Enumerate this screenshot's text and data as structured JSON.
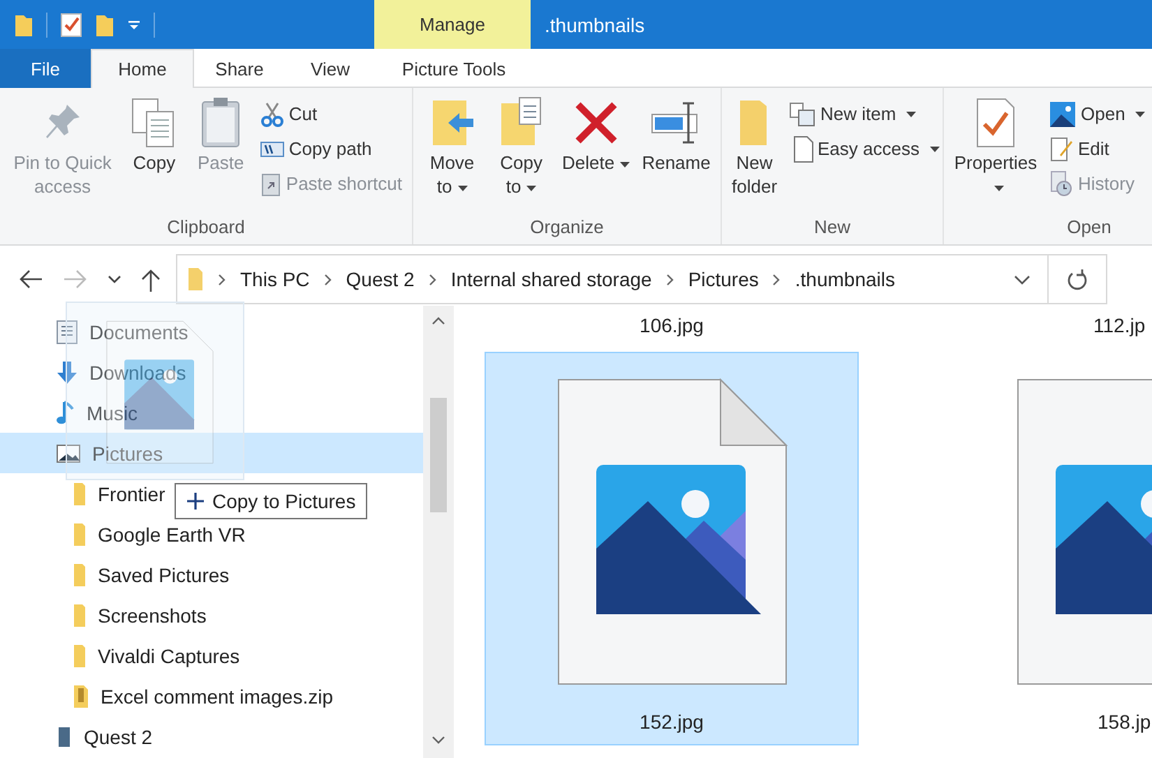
{
  "window": {
    "title": ".thumbnails"
  },
  "contextual_tab": {
    "label": "Manage"
  },
  "ribbon_tabs": [
    {
      "label": "File",
      "kind": "file",
      "selected": false
    },
    {
      "label": "Home",
      "kind": "tab",
      "selected": true
    },
    {
      "label": "Share",
      "kind": "tab",
      "selected": false
    },
    {
      "label": "View",
      "kind": "tab",
      "selected": false
    },
    {
      "label": "Picture Tools",
      "kind": "tab",
      "selected": false
    }
  ],
  "ribbon_groups": [
    {
      "label": "Clipboard",
      "commands": [
        {
          "label": "Pin to Quick access",
          "kind": "large",
          "disabled": true,
          "dropdown": false
        },
        {
          "label": "Copy",
          "kind": "large",
          "disabled": false,
          "dropdown": false
        },
        {
          "label": "Paste",
          "kind": "large",
          "disabled": true,
          "dropdown": false
        },
        {
          "label": "Cut",
          "kind": "small",
          "disabled": false,
          "dropdown": false
        },
        {
          "label": "Copy path",
          "kind": "small",
          "disabled": false,
          "dropdown": false
        },
        {
          "label": "Paste shortcut",
          "kind": "small",
          "disabled": true,
          "dropdown": false
        }
      ]
    },
    {
      "label": "Organize",
      "commands": [
        {
          "label": "Move to",
          "kind": "large",
          "disabled": false,
          "dropdown": true
        },
        {
          "label": "Copy to",
          "kind": "large",
          "disabled": false,
          "dropdown": true
        },
        {
          "label": "Delete",
          "kind": "large",
          "disabled": false,
          "dropdown": true
        },
        {
          "label": "Rename",
          "kind": "large",
          "disabled": false,
          "dropdown": false
        }
      ]
    },
    {
      "label": "New",
      "commands": [
        {
          "label": "New folder",
          "kind": "large",
          "disabled": false,
          "dropdown": false
        },
        {
          "label": "New item",
          "kind": "small",
          "disabled": false,
          "dropdown": true
        },
        {
          "label": "Easy access",
          "kind": "small",
          "disabled": false,
          "dropdown": true
        }
      ]
    },
    {
      "label": "Open",
      "commands": [
        {
          "label": "Properties",
          "kind": "large",
          "disabled": false,
          "dropdown": true
        },
        {
          "label": "Open",
          "kind": "small",
          "disabled": false,
          "dropdown": true
        },
        {
          "label": "Edit",
          "kind": "small",
          "disabled": false,
          "dropdown": false
        },
        {
          "label": "History",
          "kind": "small",
          "disabled": true,
          "dropdown": false
        }
      ]
    }
  ],
  "address_bar": {
    "path": [
      "This PC",
      "Quest 2",
      "Internal shared storage",
      "Pictures",
      ".thumbnails"
    ]
  },
  "navigation_pane": [
    {
      "label": "Documents",
      "kind": "documents",
      "selected": false
    },
    {
      "label": "Downloads",
      "kind": "downloads",
      "selected": false
    },
    {
      "label": "Music",
      "kind": "music",
      "selected": false
    },
    {
      "label": "Pictures",
      "kind": "pictures",
      "selected": true,
      "children": [
        {
          "label": "Frontier",
          "kind": "folder",
          "selected": false
        },
        {
          "label": "Google Earth VR",
          "kind": "folder",
          "selected": false
        },
        {
          "label": "Saved Pictures",
          "kind": "folder",
          "selected": false
        },
        {
          "label": "Screenshots",
          "kind": "folder",
          "selected": false
        },
        {
          "label": "Vivaldi Captures",
          "kind": "folder",
          "selected": false
        },
        {
          "label": "Excel comment images.zip",
          "kind": "zip",
          "selected": false
        }
      ]
    },
    {
      "label": "Quest 2",
      "kind": "device",
      "selected": false
    }
  ],
  "drag_tooltip": {
    "text": "Copy to Pictures"
  },
  "files": [
    {
      "name": "106.jpg",
      "kind": "caption",
      "selected": false
    },
    {
      "name": "112.jp",
      "kind": "caption",
      "selected": false
    },
    {
      "name": "152.jpg",
      "kind": "tile",
      "selected": true
    },
    {
      "name": "158.jp",
      "kind": "tile",
      "selected": false
    }
  ]
}
